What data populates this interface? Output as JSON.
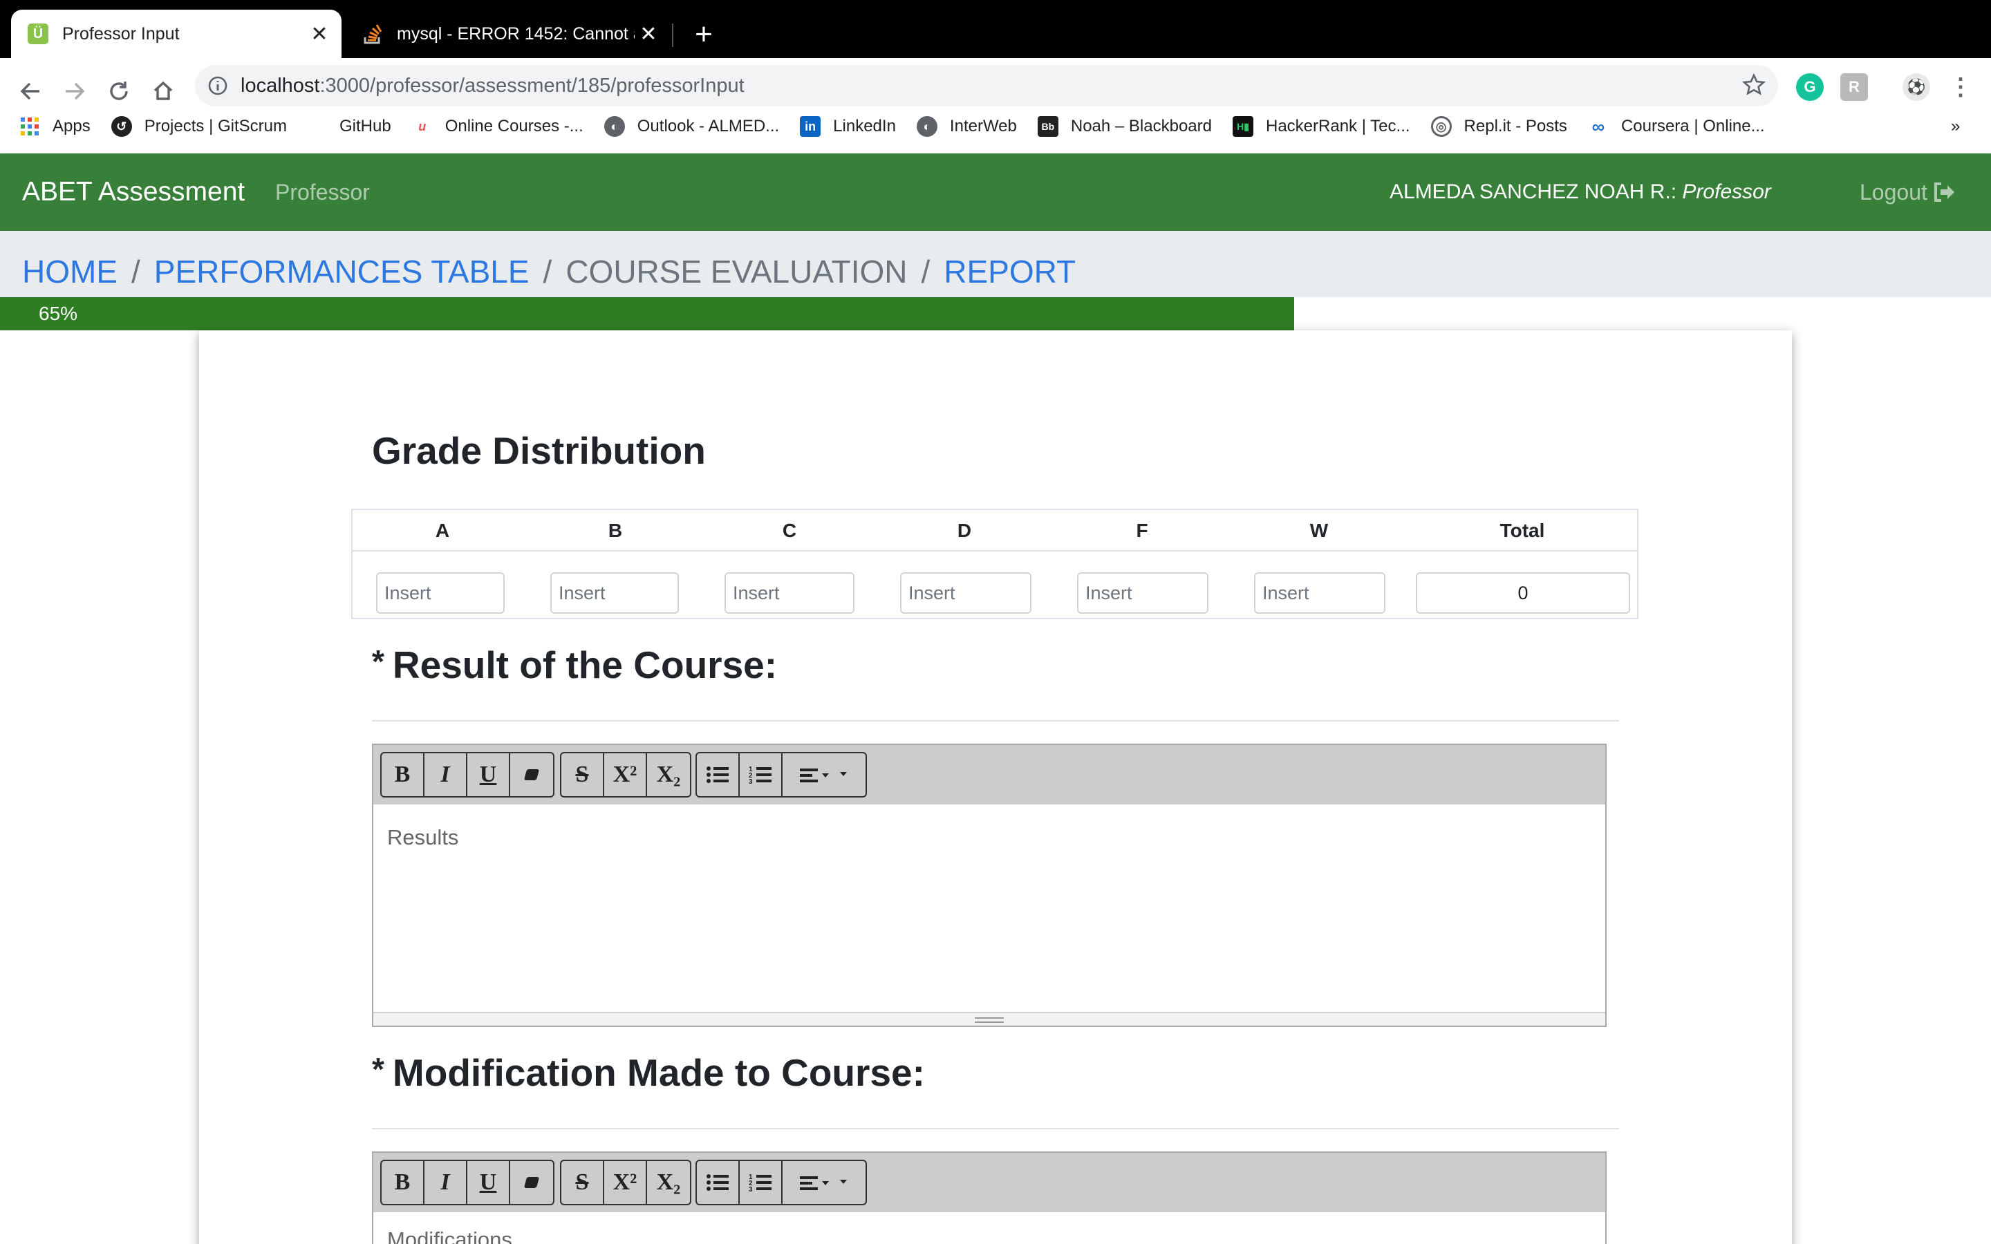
{
  "browser": {
    "tabs": [
      {
        "title": "Professor Input",
        "favicon": "uvicorn-icon",
        "active": true
      },
      {
        "title": "mysql - ERROR 1452: Cannot a",
        "favicon": "stackoverflow-icon",
        "active": false
      }
    ],
    "url": {
      "host": "localhost",
      "path": ":3000/professor/assessment/185/professorInput"
    },
    "bookmarks": [
      {
        "label": "Apps",
        "icon": "apps-grid-icon"
      },
      {
        "label": "Projects | GitScrum",
        "icon": "gitscrum-icon"
      },
      {
        "label": "GitHub",
        "icon": "github-icon"
      },
      {
        "label": "Online Courses -...",
        "icon": "udemy-icon"
      },
      {
        "label": "Outlook - ALMED...",
        "icon": "globe-icon"
      },
      {
        "label": "LinkedIn",
        "icon": "linkedin-icon"
      },
      {
        "label": "InterWeb",
        "icon": "globe-icon"
      },
      {
        "label": "Noah – Blackboard",
        "icon": "blackboard-icon"
      },
      {
        "label": "HackerRank | Tec...",
        "icon": "hackerrank-icon"
      },
      {
        "label": "Repl.it - Posts",
        "icon": "replit-icon"
      },
      {
        "label": "Coursera | Online...",
        "icon": "coursera-icon"
      }
    ],
    "more_bookmarks": "»"
  },
  "app": {
    "brand": "ABET Assessment",
    "nav_link": "Professor",
    "user_name": "ALMEDA SANCHEZ NOAH R.:",
    "user_role": "Professor",
    "logout_label": "Logout",
    "brand_color": "#38803a"
  },
  "breadcrumb": {
    "home": "HOME",
    "performances": "PERFORMANCES TABLE",
    "course_eval": "COURSE EVALUATION",
    "report": "REPORT",
    "sep": "/"
  },
  "progress": {
    "value": 0.65,
    "label": "65%"
  },
  "grade_distribution": {
    "title": "Grade Distribution",
    "columns": [
      "A",
      "B",
      "C",
      "D",
      "F",
      "W",
      "Total"
    ],
    "placeholder": "Insert",
    "total_value": "0"
  },
  "result_section": {
    "asterisk": "*",
    "title": "Result of the Course:",
    "placeholder": "Results"
  },
  "modification_section": {
    "asterisk": "*",
    "title": "Modification Made to Course:",
    "placeholder": "Modifications"
  },
  "editor_toolbar": {
    "bold": "B",
    "italic": "I",
    "underline": "U",
    "strike": "S",
    "superscript": "X²",
    "subscript": "X₂"
  }
}
